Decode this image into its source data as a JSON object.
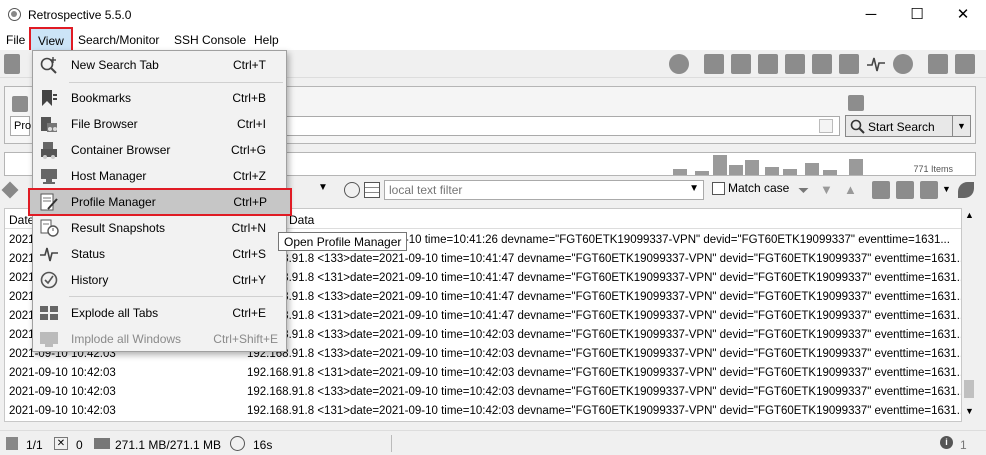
{
  "window": {
    "title": "Retrospective 5.5.0",
    "minimize": "─",
    "maximize": "☐",
    "close": "✕"
  },
  "menubar": [
    {
      "label": "File"
    },
    {
      "label": "View"
    },
    {
      "label": "Search/Monitor"
    },
    {
      "label": "SSH Console"
    },
    {
      "label": "Help"
    }
  ],
  "search": {
    "button_label": "Start Search",
    "prefix": "Pro"
  },
  "histogram": {
    "count_label": "771 Items"
  },
  "filter": {
    "placeholder": "local text filter",
    "match_case": "Match case"
  },
  "grid": {
    "columns": [
      "Date",
      "Data"
    ],
    "rows": [
      {
        "date": "2021-",
        "data": "<131>date=2021-09-10 time=10:41:26 devname=\"FGT60ETK19099337-VPN\" devid=\"FGT60ETK19099337\" eventtime=1631..."
      },
      {
        "date": "2021-",
        "data": "192.168.91.8 <133>date=2021-09-10 time=10:41:47 devname=\"FGT60ETK19099337-VPN\" devid=\"FGT60ETK19099337\" eventtime=1631..."
      },
      {
        "date": "2021-",
        "data": "192.168.91.8 <131>date=2021-09-10 time=10:41:47 devname=\"FGT60ETK19099337-VPN\" devid=\"FGT60ETK19099337\" eventtime=1631..."
      },
      {
        "date": "2021-",
        "data": "192.168.91.8 <133>date=2021-09-10 time=10:41:47 devname=\"FGT60ETK19099337-VPN\" devid=\"FGT60ETK19099337\" eventtime=1631..."
      },
      {
        "date": "2021-",
        "data": "192.168.91.8 <131>date=2021-09-10 time=10:41:47 devname=\"FGT60ETK19099337-VPN\" devid=\"FGT60ETK19099337\" eventtime=1631..."
      },
      {
        "date": "2021-",
        "data": "192.168.91.8 <133>date=2021-09-10 time=10:42:03 devname=\"FGT60ETK19099337-VPN\" devid=\"FGT60ETK19099337\" eventtime=1631..."
      },
      {
        "date": "2021-09-10 10:42:03",
        "data": "192.168.91.8 <133>date=2021-09-10 time=10:42:03 devname=\"FGT60ETK19099337-VPN\" devid=\"FGT60ETK19099337\" eventtime=1631..."
      },
      {
        "date": "2021-09-10 10:42:03",
        "data": "192.168.91.8 <131>date=2021-09-10 time=10:42:03 devname=\"FGT60ETK19099337-VPN\" devid=\"FGT60ETK19099337\" eventtime=1631..."
      },
      {
        "date": "2021-09-10 10:42:03",
        "data": "192.168.91.8 <133>date=2021-09-10 time=10:42:03 devname=\"FGT60ETK19099337-VPN\" devid=\"FGT60ETK19099337\" eventtime=1631..."
      },
      {
        "date": "2021-09-10 10:42:03",
        "data": "192.168.91.8 <131>date=2021-09-10 time=10:42:03 devname=\"FGT60ETK19099337-VPN\" devid=\"FGT60ETK19099337\" eventtime=1631..."
      }
    ]
  },
  "status": {
    "tabs": "1/1",
    "closed": "0",
    "memory": "271.1 MB/271.1 MB",
    "time": "16s",
    "info_count": "1"
  },
  "view_menu": {
    "items": [
      {
        "label": "New Search Tab",
        "shortcut": "Ctrl+T",
        "icon": "search-plus-icon"
      },
      {
        "label": "Bookmarks",
        "shortcut": "Ctrl+B",
        "icon": "bookmark-icon"
      },
      {
        "label": "File Browser",
        "shortcut": "Ctrl+I",
        "icon": "file-browser-icon"
      },
      {
        "label": "Container Browser",
        "shortcut": "Ctrl+G",
        "icon": "container-icon"
      },
      {
        "label": "Host Manager",
        "shortcut": "Ctrl+Z",
        "icon": "host-icon"
      },
      {
        "label": "Profile Manager",
        "shortcut": "Ctrl+P",
        "icon": "profile-icon"
      },
      {
        "label": "Result Snapshots",
        "shortcut": "Ctrl+N",
        "icon": "snapshot-icon"
      },
      {
        "label": "Status",
        "shortcut": "Ctrl+S",
        "icon": "pulse-icon"
      },
      {
        "label": "History",
        "shortcut": "Ctrl+Y",
        "icon": "clock-icon"
      },
      {
        "label": "Explode all Tabs",
        "shortcut": "Ctrl+E",
        "icon": "explode-icon"
      },
      {
        "label": "Implode all Windows",
        "shortcut": "Ctrl+Shift+E",
        "icon": "implode-icon"
      }
    ],
    "tooltip": "Open Profile Manager"
  },
  "colors": {
    "highlight_border": "#e01b24",
    "menu_highlight": "#c6c6c6"
  }
}
